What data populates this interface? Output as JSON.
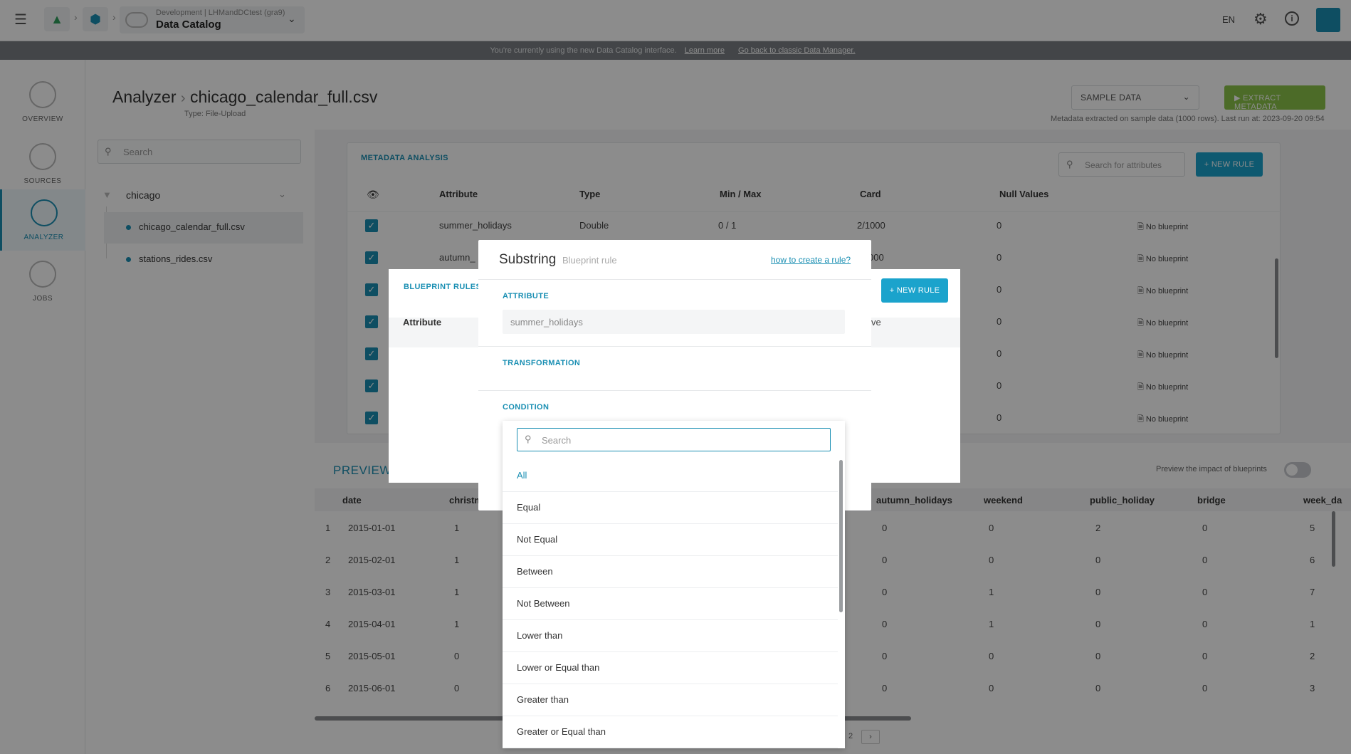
{
  "topbar": {
    "env_label": "Development | LHMandDCtest (gra9)",
    "app_title": "Data Catalog",
    "lang": "EN"
  },
  "banner": {
    "text": "You're currently using the new Data Catalog interface.",
    "learn_more": "Learn more",
    "go_back": "Go back to classic Data Manager."
  },
  "nav": [
    {
      "label": "OVERVIEW"
    },
    {
      "label": "SOURCES"
    },
    {
      "label": "ANALYZER"
    },
    {
      "label": "JOBS"
    }
  ],
  "header": {
    "root": "Analyzer",
    "file": "chicago_calendar_full.csv",
    "type_label": "Type:",
    "type_value": "File-Upload",
    "sample_select": "SAMPLE DATA",
    "extract_button": "EXTRACT METADATA",
    "meta_note": "Metadata extracted on sample data (1000 rows).  Last run at:  2023-09-20 09:54"
  },
  "tree": {
    "search_placeholder": "Search",
    "root": "chicago",
    "files": [
      "chicago_calendar_full.csv",
      "stations_rides.csv"
    ]
  },
  "metadata": {
    "title": "METADATA ANALYSIS",
    "search_placeholder": "Search for attributes",
    "new_rule": "NEW RULE",
    "columns": [
      "Attribute",
      "Type",
      "Min / Max",
      "Card",
      "Null Values"
    ],
    "rows": [
      {
        "attribute": "summer_holidays",
        "type": "Double",
        "minmax": "0 / 1",
        "card": "2/1000",
        "nulls": "0",
        "blueprint": "No blueprint"
      },
      {
        "attribute": "autumn_",
        "type": "",
        "minmax": "",
        "card": "000",
        "nulls": "0",
        "blueprint": "No blueprint"
      },
      {
        "attribute": "",
        "type": "",
        "minmax": "",
        "card": "",
        "nulls": "0",
        "blueprint": "No blueprint"
      },
      {
        "attribute": "",
        "type": "",
        "minmax": "",
        "card": "",
        "nulls": "0",
        "blueprint": "No blueprint"
      },
      {
        "attribute": "",
        "type": "",
        "minmax": "",
        "card": "",
        "nulls": "0",
        "blueprint": "No blueprint"
      },
      {
        "attribute": "",
        "type": "",
        "minmax": "",
        "card": "",
        "nulls": "0",
        "blueprint": "No blueprint"
      },
      {
        "attribute": "",
        "type": "",
        "minmax": "",
        "card": "",
        "nulls": "0",
        "blueprint": "No blueprint"
      }
    ]
  },
  "preview": {
    "title": "PREVIEW",
    "toggle_label": "Preview the impact of blueprints",
    "columns": [
      "date",
      "christm",
      "autumn_holidays",
      "weekend",
      "public_holiday",
      "bridge",
      "week_da"
    ],
    "rows": [
      {
        "n": "1",
        "date": "2015-01-01",
        "christmas": "1",
        "autumn": "0",
        "weekend": "0",
        "public": "2",
        "bridge": "0",
        "week": "5"
      },
      {
        "n": "2",
        "date": "2015-02-01",
        "christmas": "1",
        "autumn": "0",
        "weekend": "0",
        "public": "0",
        "bridge": "0",
        "week": "6"
      },
      {
        "n": "3",
        "date": "2015-03-01",
        "christmas": "1",
        "autumn": "0",
        "weekend": "1",
        "public": "0",
        "bridge": "0",
        "week": "7"
      },
      {
        "n": "4",
        "date": "2015-04-01",
        "christmas": "1",
        "autumn": "0",
        "weekend": "1",
        "public": "0",
        "bridge": "0",
        "week": "1"
      },
      {
        "n": "5",
        "date": "2015-05-01",
        "christmas": "0",
        "autumn": "0",
        "weekend": "0",
        "public": "0",
        "bridge": "0",
        "week": "2"
      },
      {
        "n": "6",
        "date": "2015-06-01",
        "christmas": "0",
        "autumn": "0",
        "weekend": "0",
        "public": "0",
        "bridge": "0",
        "week": "3"
      }
    ],
    "page": "2"
  },
  "blueprint_modal": {
    "title": "BLUEPRINT RULES",
    "col_attribute": "Attribute",
    "col_partial": "ve",
    "new_rule": "NEW RULE"
  },
  "dialog": {
    "title": "Substring",
    "subtitle": "Blueprint rule",
    "help_link": "how to create a rule?",
    "attribute_label": "ATTRIBUTE",
    "attribute_value": "summer_holidays",
    "transformation_label": "TRANSFORMATION",
    "condition_label": "CONDITION",
    "condition_search_placeholder": "Search",
    "condition_options": [
      "All",
      "Equal",
      "Not Equal",
      "Between",
      "Not Between",
      "Lower than",
      "Lower or Equal than",
      "Greater than",
      "Greater or Equal than"
    ]
  },
  "colors": {
    "accent": "#1a8fb3",
    "button_blue": "#1ba3cc",
    "extract_green": "#8bc34a"
  }
}
